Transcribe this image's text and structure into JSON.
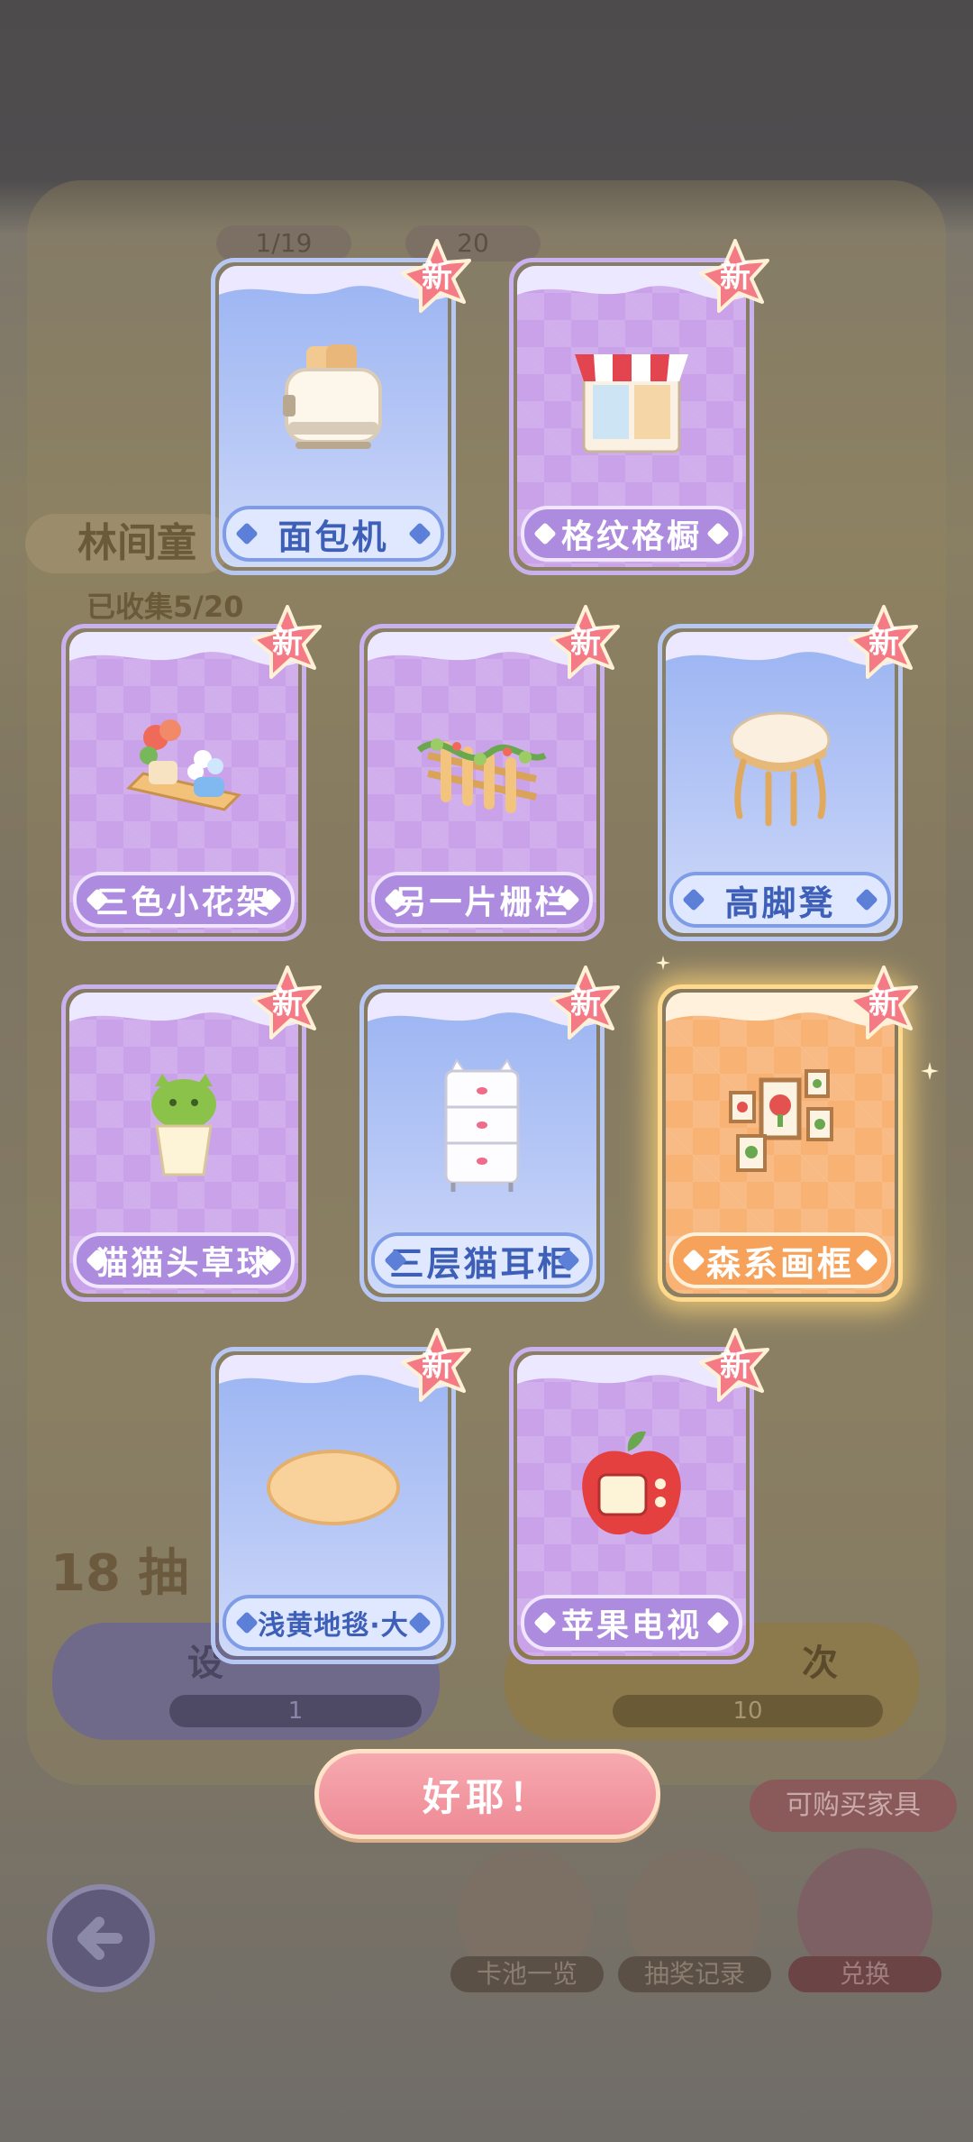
{
  "background": {
    "counter_left": "1/19",
    "counter_right": "20",
    "set_title": "林间童",
    "collected": "已收集5/20",
    "draws_left": "18 抽",
    "btn_single_label": "设",
    "btn_single_count": "1",
    "btn_multi_label": "次",
    "btn_multi_count": "10",
    "buyable_tag": "可购买家具",
    "nav": [
      "卡池一览",
      "抽奖记录",
      "兑换"
    ]
  },
  "new_badge": "新",
  "cards": [
    {
      "name": "面包机",
      "theme": "blue",
      "icon": "toaster-icon"
    },
    {
      "name": "格纹格橱",
      "theme": "purple",
      "icon": "checkered-cabinet-icon"
    },
    {
      "name": "三色小花架",
      "theme": "purple",
      "icon": "flower-shelf-icon"
    },
    {
      "name": "另一片栅栏",
      "theme": "purple",
      "icon": "fence-icon"
    },
    {
      "name": "高脚凳",
      "theme": "blue",
      "icon": "stool-icon"
    },
    {
      "name": "猫猫头草球",
      "theme": "purple",
      "icon": "cat-grass-pot-icon"
    },
    {
      "name": "三层猫耳柜",
      "theme": "blue",
      "icon": "cat-ear-cabinet-icon"
    },
    {
      "name": "森系画框",
      "theme": "orange",
      "icon": "picture-frames-icon"
    },
    {
      "name": "浅黄地毯·大",
      "theme": "blue",
      "icon": "yellow-rug-icon"
    },
    {
      "name": "苹果电视",
      "theme": "purple",
      "icon": "apple-tv-icon"
    }
  ],
  "ok_button": "好耶！",
  "colors": {
    "purple": "#c9a2ea",
    "blue": "#9ab4f2",
    "orange": "#f7b274",
    "badge": "#f47a86",
    "button": "#ee8a95"
  }
}
